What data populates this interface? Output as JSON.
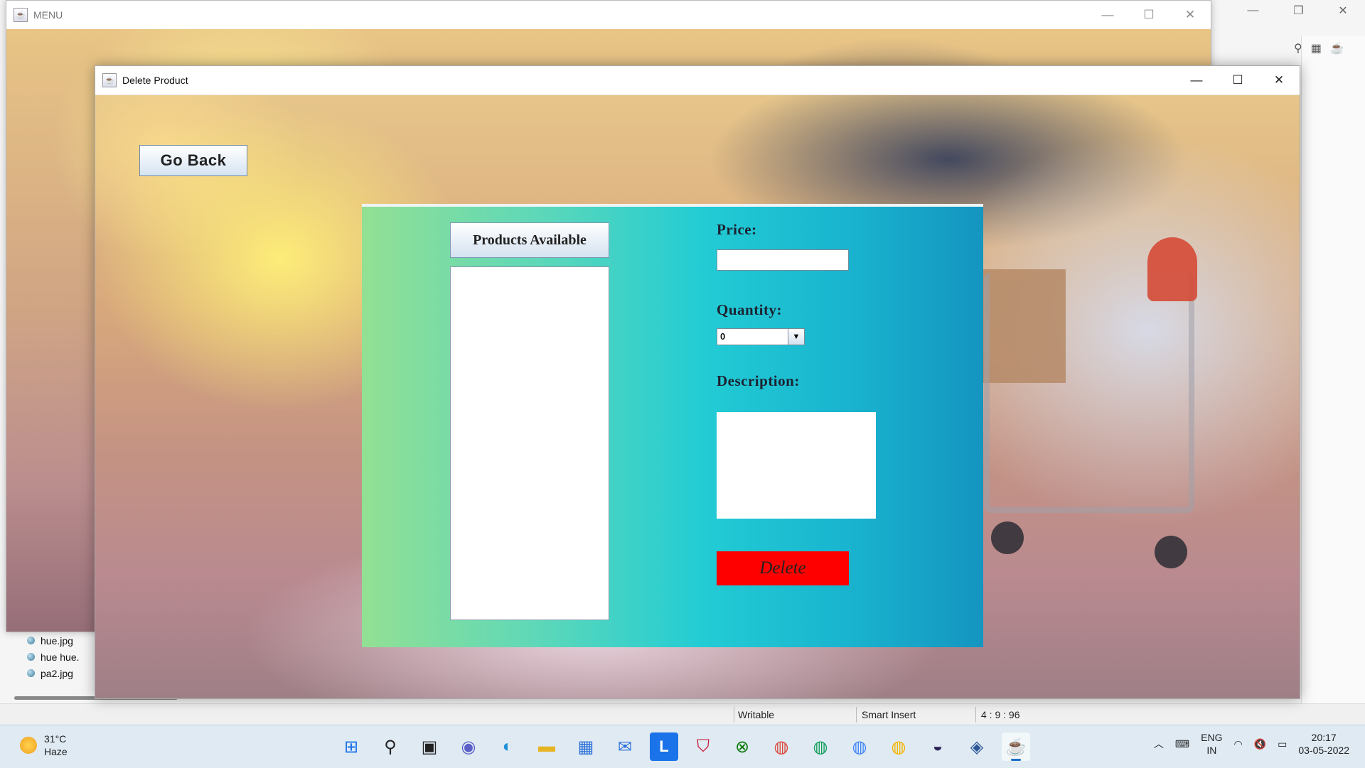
{
  "menu_window": {
    "title": "MENU",
    "minimize": "—",
    "maximize": "☐",
    "close": "✕"
  },
  "delete_window": {
    "title": "Delete Product",
    "minimize": "—",
    "maximize": "☐",
    "close": "✕",
    "go_back_label": "Go Back",
    "products_available_label": "Products Available",
    "price_label": "Price:",
    "price_value": "",
    "quantity_label": "Quantity:",
    "quantity_value": "0",
    "description_label": "Description:",
    "description_value": "",
    "delete_label": "Delete",
    "delete_color": "#ff0000"
  },
  "ide": {
    "explorer_items": [
      "hue.jpg",
      "hue hue.",
      "pa2.jpg"
    ],
    "status": {
      "writable": "Writable",
      "insert_mode": "Smart Insert",
      "position": "4 : 9 : 96"
    }
  },
  "taskbar": {
    "weather_temp": "31°C",
    "weather_desc": "Haze",
    "lang_top": "ENG",
    "lang_bottom": "IN",
    "time": "20:17",
    "date": "03-05-2022"
  }
}
